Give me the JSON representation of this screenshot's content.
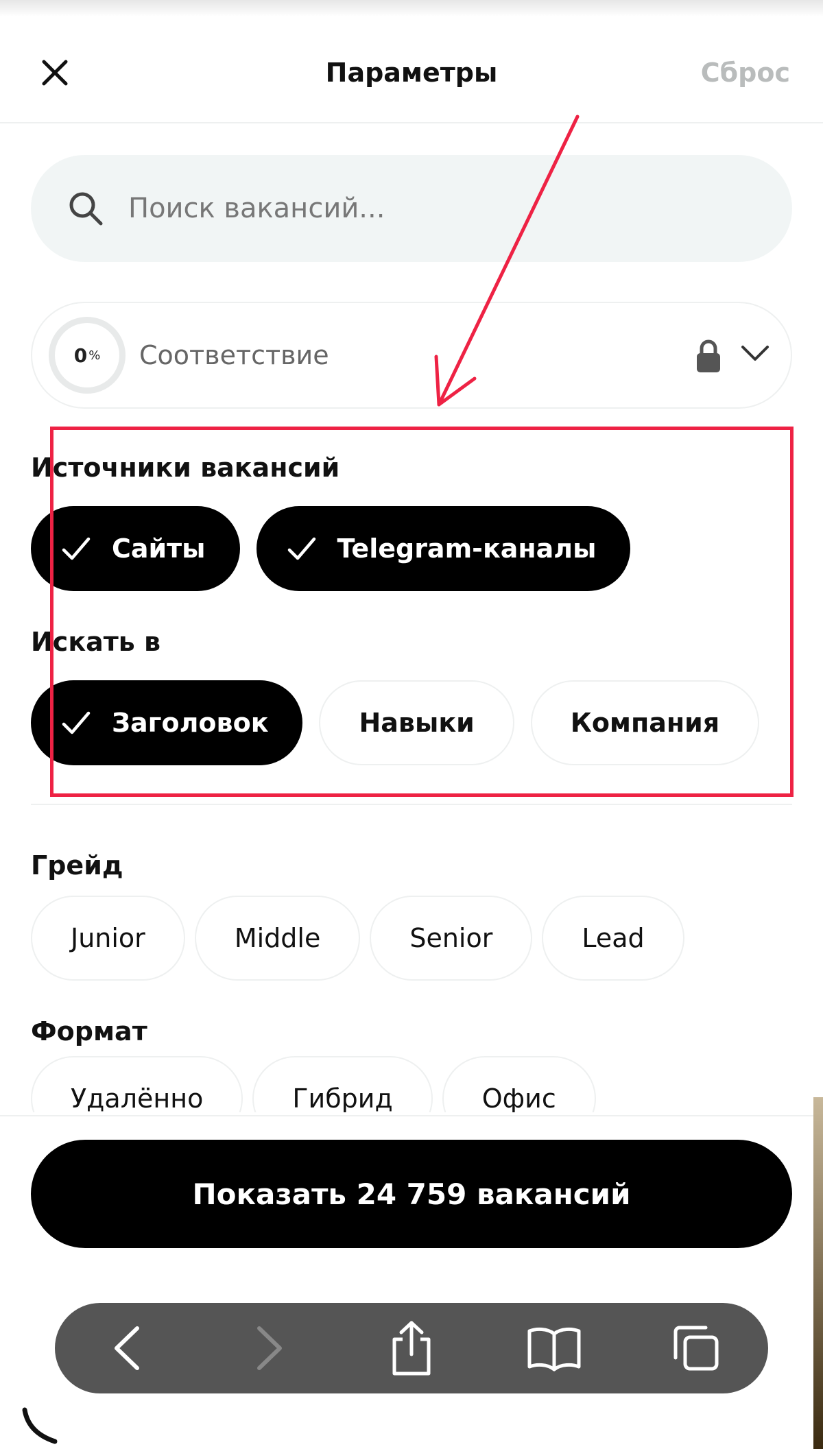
{
  "header": {
    "title": "Параметры",
    "reset_label": "Сброс",
    "reset_color": "#b9bcbc"
  },
  "search": {
    "placeholder": "Поиск вакансий..."
  },
  "match": {
    "value": "0",
    "unit": "%",
    "label": "Соответствие",
    "locked": true
  },
  "sources": {
    "title": "Источники вакансий",
    "chips": [
      {
        "label": "Сайты",
        "selected": true
      },
      {
        "label": "Telegram-каналы",
        "selected": true
      }
    ]
  },
  "search_in": {
    "title": "Искать в",
    "chips": [
      {
        "label": "Заголовок",
        "selected": true
      },
      {
        "label": "Навыки",
        "selected": false
      },
      {
        "label": "Компания",
        "selected": false
      }
    ]
  },
  "grade": {
    "title": "Грейд",
    "chips": [
      {
        "label": "Junior",
        "selected": false
      },
      {
        "label": "Middle",
        "selected": false
      },
      {
        "label": "Senior",
        "selected": false
      },
      {
        "label": "Lead",
        "selected": false
      }
    ]
  },
  "format": {
    "title": "Формат",
    "chips": [
      {
        "label": "Удалённо",
        "selected": false
      },
      {
        "label": "Гибрид",
        "selected": false
      },
      {
        "label": "Офис",
        "selected": false
      }
    ]
  },
  "show_button": {
    "label": "Показать 24 759 вакансий"
  },
  "annotation": {
    "color": "#ee2244"
  },
  "browser_toolbar": {
    "icons": [
      "back-icon",
      "forward-icon",
      "share-icon",
      "bookmarks-icon",
      "tabs-icon"
    ]
  }
}
